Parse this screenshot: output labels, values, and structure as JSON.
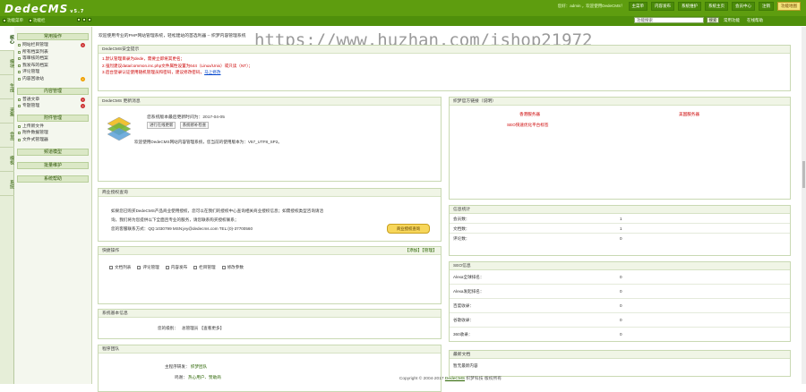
{
  "app": {
    "logo": "DedeCMS",
    "version": "v5.7"
  },
  "topnav": {
    "user_text": "您好：admin ，欢迎使用DedeCMS！",
    "items": [
      "主菜单",
      "内容发布",
      "系统维护",
      "系统主页",
      "会员中心",
      "注销"
    ],
    "feature_btn": "功能地图"
  },
  "subbar": {
    "left_items": [
      "功能菜单",
      "功能栏"
    ],
    "search_placeholder": "功能搜索",
    "search_btn": "搜索",
    "links": [
      "常用功能",
      "在线帮助"
    ]
  },
  "sidebar": {
    "tabs": [
      "核心",
      "模块",
      "生成",
      "采集",
      "会员",
      "模板",
      "系统"
    ],
    "sections": [
      {
        "title": "常用操作",
        "items": [
          {
            "label": "网站栏目管理",
            "tag": "x"
          },
          {
            "label": "所有档案列表",
            "tag": ""
          },
          {
            "label": "等审核的档案",
            "tag": ""
          },
          {
            "label": "我发布的档案",
            "tag": ""
          },
          {
            "label": "评论管理",
            "tag": ""
          },
          {
            "label": "内容回收站",
            "tag": "o"
          }
        ]
      },
      {
        "title": "内容管理",
        "items": [
          {
            "label": "普通文章",
            "tag": "x"
          },
          {
            "label": "专题管理",
            "tag": "x"
          }
        ]
      },
      {
        "title": "附件管理",
        "items": [
          {
            "label": "上传新文件",
            "tag": ""
          },
          {
            "label": "附件数据管理",
            "tag": ""
          },
          {
            "label": "文件式管理器",
            "tag": ""
          }
        ]
      },
      {
        "title": "频道模型",
        "items": []
      },
      {
        "title": "批量维护",
        "items": []
      },
      {
        "title": "系统帮助",
        "items": []
      }
    ]
  },
  "main": {
    "notice": "欢迎使用专业的PHP网站管理系统，轻松建站的首选利器 -- 织梦内容管理系统",
    "watermark": "https://www.huzhan.com/ishop21972",
    "security": {
      "title": "DedeCMS安全提示",
      "lines": [
        "1.默认管理目录为dede，需要立即将其更名；",
        "2.强烈建议data/common.inc.php文件属性设置为644（Linux/Unix）或只读（NT）；",
        "3.后台登录认证使用随机管理员和密码，建议修改密码，<a>马上修改</a>"
      ]
    },
    "update": {
      "title": "DedeCMS 更新消息",
      "version_line": "您系统版本最后更新时间为：2017-04-05",
      "btn_check": "进行在线更新",
      "btn_patch": "系统修补检查",
      "info_line": "欢迎使用DedeCMS网站内容管理系统，您当前的使用版本为：V57_UTF8_SP2。"
    },
    "license": {
      "title": "商业授权查询",
      "para1": "如果您已购买DedeCMS产品商业使用授权，您可以在我们的授权中心查询相关商业授权信息；如需授权类型咨询请洽",
      "para2": "询，我们将为您提供以下全面且专业的服务，请您联系购买授权联系；",
      "contact": "您的客服联系方式：QQ:1030799 MSN:jey@dedecms.com TEL:(0)-37700560",
      "btn": "商业授权查询"
    },
    "quick": {
      "title": "快捷操作",
      "right": "【添加】【管理】",
      "items": [
        "文档列表",
        "评论管理",
        "内容发布",
        "栏目管理",
        "修改参数"
      ]
    },
    "sysinfo": {
      "title": "系统基本信息",
      "label": "您的级别：",
      "value": "总管理员 【查看更多】"
    },
    "team": {
      "title": "程序团队",
      "rows": [
        {
          "label": "主程序研发：",
          "value": "织梦团队"
        },
        {
          "label": "鸣谢：",
          "value": "热心用户、赞助商"
        }
      ]
    }
  },
  "right": {
    "official": {
      "title": "织梦官方链接（说明）",
      "links": [
        "香港服务器",
        "美国服务器",
        "SEO快速优化平台标签"
      ]
    },
    "stats": {
      "title": "信息统计",
      "rows": [
        {
          "label": "会员数：",
          "value": "1"
        },
        {
          "label": "文档数：",
          "value": "1"
        },
        {
          "label": "评论数：",
          "value": "0"
        }
      ]
    },
    "seo": {
      "title": "SEO信息",
      "rows": [
        {
          "label": "Alexa全球排名：",
          "value": "0"
        },
        {
          "label": "Alexa发起排名：",
          "value": "0"
        },
        {
          "label": "百度收录：",
          "value": "0"
        },
        {
          "label": "谷歌收录：",
          "value": "0"
        },
        {
          "label": "360收录：",
          "value": "0"
        }
      ]
    },
    "latest": {
      "title": "最新文档",
      "text": "暂无最新内容"
    }
  },
  "footer": {
    "copy": "Copyright © 2004-2017 ",
    "brand": "DedeCMS",
    "rest": " 织梦科技 版权所有"
  }
}
